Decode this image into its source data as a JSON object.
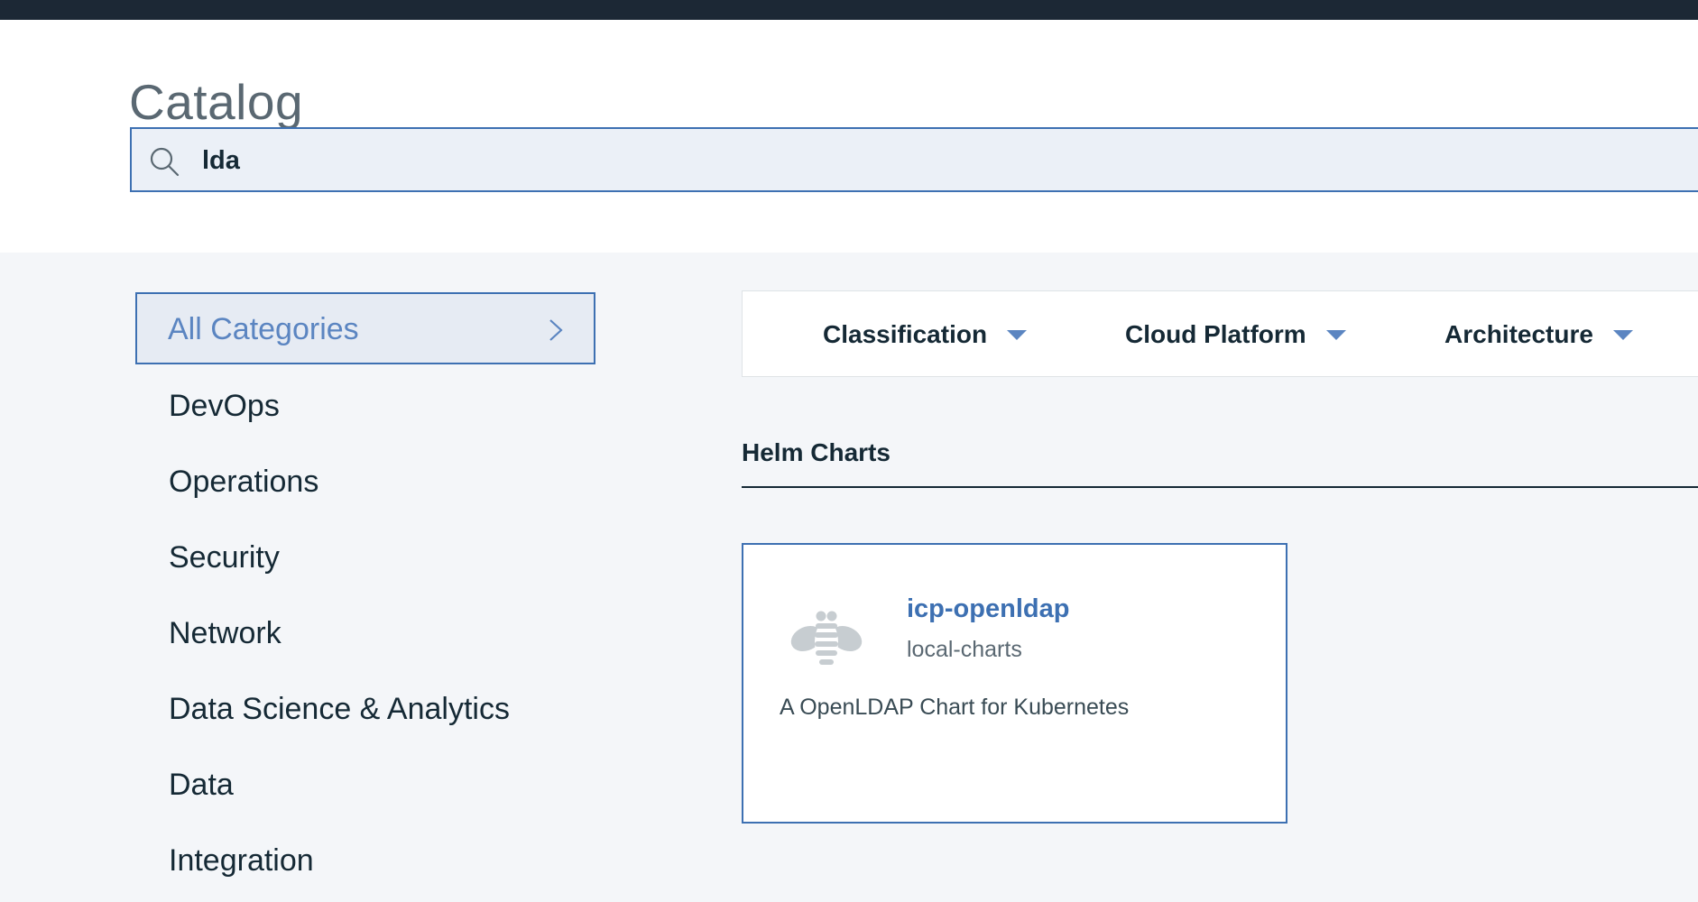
{
  "header": {
    "title": "Catalog"
  },
  "search": {
    "value": "lda",
    "icon": "search-icon"
  },
  "sidebar": {
    "selected": {
      "label": "All Categories",
      "icon": "chevron-right-icon"
    },
    "items": [
      {
        "label": "DevOps"
      },
      {
        "label": "Operations"
      },
      {
        "label": "Security"
      },
      {
        "label": "Network"
      },
      {
        "label": "Data Science & Analytics"
      },
      {
        "label": "Data"
      },
      {
        "label": "Integration"
      }
    ]
  },
  "filters": [
    {
      "label": "Classification"
    },
    {
      "label": "Cloud Platform"
    },
    {
      "label": "Architecture"
    }
  ],
  "section": {
    "title": "Helm Charts"
  },
  "cards": [
    {
      "title": "icp-openldap",
      "repo": "local-charts",
      "description": "A OpenLDAP Chart for Kubernetes",
      "icon": "bee-icon"
    }
  ],
  "colors": {
    "topbar": "#1c2835",
    "accent": "#3d70b2",
    "accent_light": "#5b85c1",
    "text_primary": "#152935",
    "text_secondary": "#5a6872",
    "background": "#f4f6f9"
  }
}
